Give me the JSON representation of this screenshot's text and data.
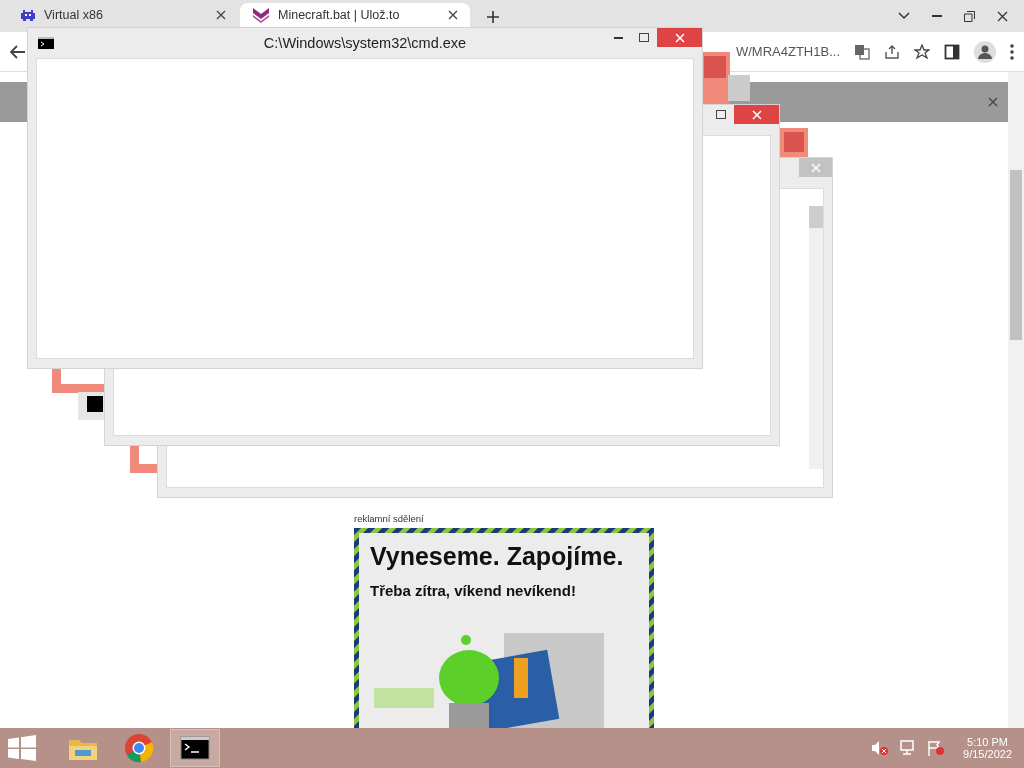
{
  "browser": {
    "tabs": [
      {
        "title": "Virtual x86",
        "selected": false
      },
      {
        "title": "Minecraft.bat | Ulož.to",
        "selected": true
      }
    ],
    "address_fragment": "W/MRA4ZTH1B..."
  },
  "page": {
    "ad_label": "reklamní sdělení",
    "ad": {
      "kind": "picture",
      "headline": "Vyneseme. Zapojíme.",
      "subline": "Třeba zítra, víkend nevíkend!"
    }
  },
  "cmd_window": {
    "title": "C:\\Windows\\system32\\cmd.exe"
  },
  "taskbar": {
    "items": [
      {
        "kind": "explorer",
        "selected": false
      },
      {
        "kind": "chrome",
        "selected": false
      },
      {
        "kind": "cmd",
        "selected": true
      }
    ],
    "time": "5:10 PM",
    "date": "9/15/2022"
  }
}
